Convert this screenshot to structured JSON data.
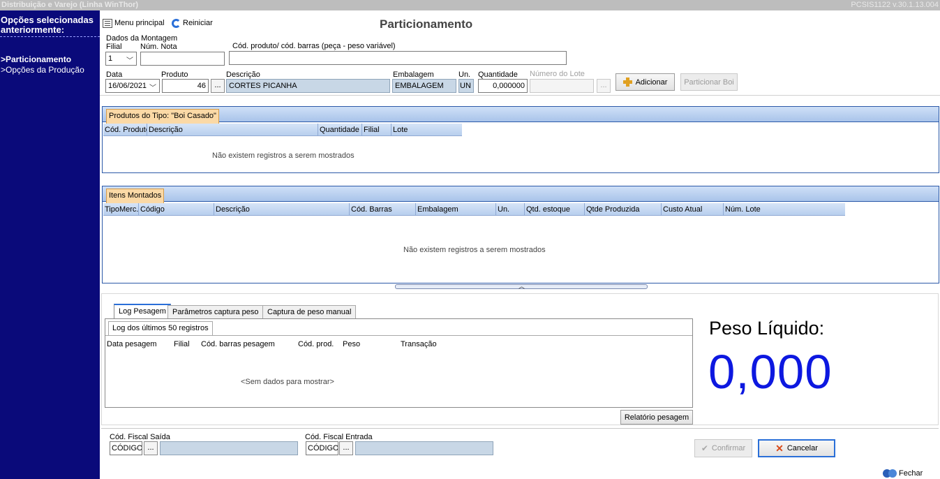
{
  "titlebar": {
    "left": "Distribuição e Varejo (Linha WinThor)",
    "right": "PCSIS1122  v.30.1.13.004"
  },
  "sidebar": {
    "header_line1": "Opções selecionadas",
    "header_line2": "anteriormente:",
    "items": [
      {
        "label": ">Particionamento"
      },
      {
        "label": ">Opções da Produção"
      }
    ]
  },
  "toolbar": {
    "menu_label": "Menu principal",
    "reset_label": "Reiniciar"
  },
  "page_title": "Particionamento",
  "form": {
    "section_label": "Dados da Montagem",
    "filial_label": "Filial",
    "filial_value": "1",
    "nota_label": "Núm. Nota",
    "nota_value": "",
    "codprod_label": "Cód. produto/ cód. barras (peça - peso variável)",
    "codprod_value": "",
    "data_label": "Data",
    "data_value": "16/06/2021",
    "produto_label": "Produto",
    "produto_value": "46",
    "descricao_label": "Descrição",
    "descricao_value": "CORTES PICANHA",
    "embalagem_label": "Embalagem",
    "embalagem_value": "EMBALAGEM",
    "un_label": "Un.",
    "un_value": "UN",
    "quantidade_label": "Quantidade",
    "quantidade_value": "0,000000",
    "lote_label": "Número do Lote",
    "lote_value": "",
    "ellipsis": "...",
    "adicionar_label": "Adicionar",
    "particionar_label": "Particionar Boi"
  },
  "produtos_group": {
    "tab_label": "Produtos do Tipo: \"Boi Casado\"",
    "columns": [
      "Cód. Produto",
      "Descrição",
      "Quantidade",
      "Filial",
      "Lote"
    ],
    "empty_message": "Não existem registros a serem mostrados"
  },
  "itens_group": {
    "tab_label": "Itens Montados",
    "columns": [
      "TipoMerc.",
      "Código",
      "Descrição",
      "Cód. Barras",
      "Embalagem",
      "Un.",
      "Qtd. estoque",
      "Qtde Produzida",
      "Custo Atual",
      "Núm. Lote"
    ],
    "empty_message": "Não existem registros a serem mostrados"
  },
  "weighing": {
    "tabs": [
      "Log Pesagem",
      "Parâmetros captura peso",
      "Captura de peso manual"
    ],
    "log_tab_label": "Log dos últimos 50 registros",
    "log_columns": [
      "Data pesagem",
      "Filial",
      "Cód. barras pesagem",
      "Cód. prod.",
      "Peso",
      "Transação"
    ],
    "log_empty": "<Sem dados para mostrar>",
    "relatorio_label": "Relatório pesagem",
    "peso_label": "Peso Líquido:",
    "peso_value": "0,000"
  },
  "fiscal": {
    "saida_label": "Cód. Fiscal Saída",
    "saida_code": "CÓDIGO",
    "entrada_label": "Cód. Fiscal Entrada",
    "entrada_code": "CÓDIGO",
    "ellipsis": "..."
  },
  "actions": {
    "confirmar_label": "Confirmar",
    "cancelar_label": "Cancelar",
    "fechar_label": "Fechar"
  }
}
